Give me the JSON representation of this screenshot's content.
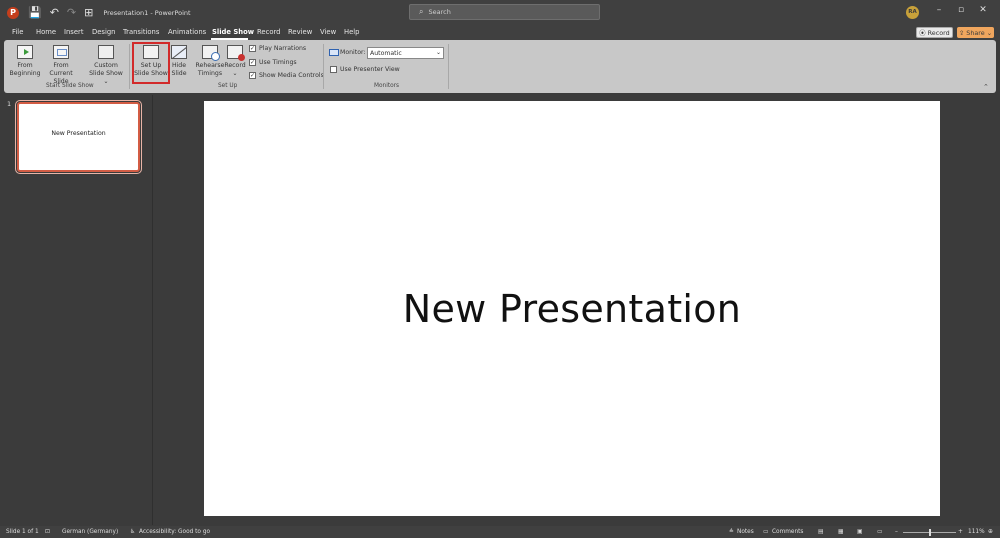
{
  "titlebar": {
    "logo": "P",
    "quick_access": [
      "💾",
      "↶",
      "↷",
      "⊞"
    ],
    "title": "Presentation1  -  PowerPoint",
    "search_placeholder": "Search",
    "avatar_initials": "RA",
    "window_controls": [
      "–",
      "▫",
      "✕"
    ]
  },
  "tabs": [
    {
      "label": "File"
    },
    {
      "label": "Home"
    },
    {
      "label": "Insert"
    },
    {
      "label": "Design"
    },
    {
      "label": "Transitions"
    },
    {
      "label": "Animations"
    },
    {
      "label": "Slide Show",
      "active": true
    },
    {
      "label": "Record"
    },
    {
      "label": "Review"
    },
    {
      "label": "View"
    },
    {
      "label": "Help"
    }
  ],
  "header_buttons": {
    "record": "⦿ Record",
    "share": "⇪ Share ⌄"
  },
  "ribbon": {
    "from_beginning": "From Beginning",
    "from_current": "From Current Slide",
    "custom_show": "Custom Slide Show ⌄",
    "setup_show": "Set Up Slide Show",
    "hide_slide": "Hide Slide",
    "rehearse": "Rehearse Timings",
    "record": "Record ⌄",
    "chk_narrations": "Play Narrations",
    "chk_timings": "Use Timings",
    "chk_media": "Show Media Controls",
    "monitor_label": "Monitor:",
    "monitor_value": "Automatic",
    "presenter_view": "Use Presenter View",
    "group_start": "Start Slide Show",
    "group_setup": "Set Up",
    "group_monitors": "Monitors"
  },
  "thumbnail": {
    "number": "1",
    "text": "New Presentation"
  },
  "slide": {
    "title": "New Presentation"
  },
  "status": {
    "slide": "Slide 1 of 1",
    "language": "German (Germany)",
    "accessibility": "Accessibility: Good to go",
    "notes": "Notes",
    "comments": "Comments",
    "zoom": "111%"
  },
  "colors": {
    "accent": "#c43e1c",
    "share": "#f0a65e",
    "highlight": "#d22a2a"
  }
}
